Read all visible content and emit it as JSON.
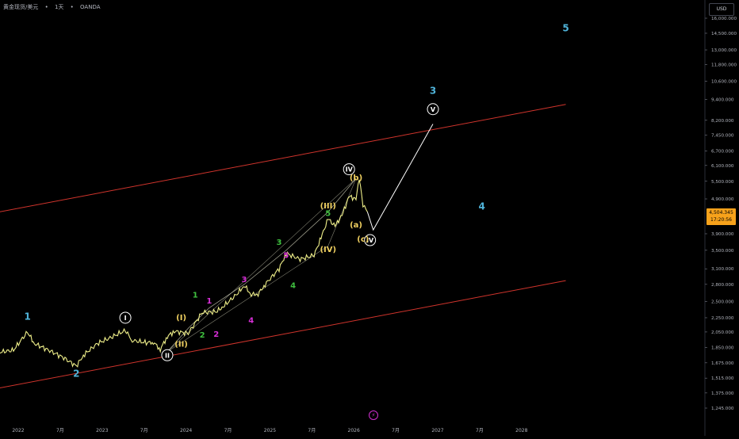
{
  "header": {
    "symbol": "黄金现货/美元",
    "sep1": "•",
    "interval": "1天",
    "sep2": "•",
    "broker": "OANDA"
  },
  "toolbar": {
    "currency": "USD"
  },
  "price_tag": {
    "price": "4,504.345",
    "countdown": "17:20:56"
  },
  "live_icon": "⚡",
  "colors": {
    "background": "#000000",
    "price_line": "#f0f08a",
    "channel": "#d0342c",
    "wave_lines": "#d8d8c0",
    "cyan": "#4fb3d9",
    "green": "#3fbf3f",
    "magenta": "#d62fd6",
    "yellow": "#f0d060",
    "white": "#ffffff",
    "tag": "#f7a21b"
  },
  "chart_data": {
    "type": "line",
    "log_scale": true,
    "grid": false,
    "x_ticks": [
      "2022",
      "7月",
      "2023",
      "7月",
      "2024",
      "7月",
      "2025",
      "7月",
      "2026",
      "7月",
      "2027",
      "7月",
      "2028"
    ],
    "y_ticks": [
      "16,000.000",
      "14,500.000",
      "13,000.000",
      "11,800.000",
      "10,600.000",
      "9,400.000",
      "8,200.000",
      "7,450.000",
      "6,700.000",
      "6,100.000",
      "5,500.000",
      "4,900.000",
      "3,900.000",
      "3,500.000",
      "3,100.000",
      "2,800.000",
      "2,500.000",
      "2,250.000",
      "2,050.000",
      "1,850.000",
      "1,675.000",
      "1,515.000",
      "1,375.000",
      "1,245.000"
    ],
    "xlim": [
      "2022-01",
      "2028-08"
    ],
    "ylim": [
      1200,
      17000
    ],
    "series": [
      {
        "points": [
          [
            "2021-11",
            1795
          ],
          [
            "2022-01",
            1820
          ],
          [
            "2022-03",
            2050
          ],
          [
            "2022-04",
            1900
          ],
          [
            "2022-06",
            1820
          ],
          [
            "2022-08",
            1740
          ],
          [
            "2022-10",
            1640
          ],
          [
            "2022-11",
            1760
          ],
          [
            "2023-01",
            1900
          ],
          [
            "2023-03",
            1980
          ],
          [
            "2023-05",
            2070
          ],
          [
            "2023-06",
            1940
          ],
          [
            "2023-08",
            1910
          ],
          [
            "2023-09",
            1920
          ],
          [
            "2023-10",
            1830
          ],
          [
            "2023-11",
            1990
          ],
          [
            "2023-12",
            2060
          ],
          [
            "2024-02",
            2030
          ],
          [
            "2024-04",
            2330
          ],
          [
            "2024-06",
            2340
          ],
          [
            "2024-07",
            2420
          ],
          [
            "2024-09",
            2630
          ],
          [
            "2024-10",
            2780
          ],
          [
            "2024-11",
            2620
          ],
          [
            "2024-12",
            2630
          ],
          [
            "2025-01",
            2800
          ],
          [
            "2025-03",
            3100
          ],
          [
            "2025-04",
            3430
          ],
          [
            "2025-06",
            3300
          ],
          [
            "2025-08",
            3390
          ],
          [
            "2025-09",
            3800
          ],
          [
            "2025-10",
            4300
          ],
          [
            "2025-11",
            4100
          ],
          [
            "2025-12",
            4400
          ],
          [
            "2026-01",
            4980
          ],
          [
            "2026-02",
            4900
          ],
          [
            "2026-02-15",
            5600
          ],
          [
            "2026-03",
            4700
          ],
          [
            "2026-03-20",
            4500
          ]
        ]
      }
    ],
    "projection": [
      [
        "2026-03-20",
        4504
      ],
      [
        "2026-04-15",
        4000
      ],
      [
        "2027-01",
        8000
      ]
    ],
    "channel_upper": [
      [
        "2021-11",
        4500
      ],
      [
        "2028-08",
        9100
      ]
    ],
    "channel_lower": [
      [
        "2021-11",
        1420
      ],
      [
        "2028-08",
        2870
      ]
    ],
    "wave_labels": [
      {
        "text": "1",
        "date": "2022-03",
        "price": 2270,
        "color": "cyan",
        "circled": false
      },
      {
        "text": "2",
        "date": "2022-10",
        "price": 1560,
        "color": "cyan",
        "circled": false
      },
      {
        "text": "3",
        "date": "2027-01",
        "price": 9950,
        "color": "cyan",
        "circled": false
      },
      {
        "text": "4",
        "date": "2027-08",
        "price": 4670,
        "color": "cyan",
        "circled": false
      },
      {
        "text": "5",
        "date": "2028-08",
        "price": 15000,
        "color": "cyan",
        "circled": false
      },
      {
        "text": "I",
        "date": "2023-05",
        "price": 2250,
        "color": "white",
        "circled": true
      },
      {
        "text": "II",
        "date": "2023-11",
        "price": 1760,
        "color": "white",
        "circled": true
      },
      {
        "text": "IV",
        "date": "2026-04",
        "price": 3740,
        "color": "white",
        "circled": true
      },
      {
        "text": "V",
        "date": "2027-01",
        "price": 8820,
        "color": "white",
        "circled": true
      },
      {
        "text": "IV",
        "date": "2026-01",
        "price": 5950,
        "color": "white",
        "circled": true
      },
      {
        "text": "(I)",
        "date": "2024-01",
        "price": 2260,
        "color": "yellow",
        "circled": false
      },
      {
        "text": "(II)",
        "date": "2024-01",
        "price": 1900,
        "color": "yellow",
        "circled": false
      },
      {
        "text": "(III)",
        "date": "2025-10",
        "price": 4700,
        "color": "yellow",
        "circled": false
      },
      {
        "text": "(IV)",
        "date": "2025-10",
        "price": 3530,
        "color": "yellow",
        "circled": false
      },
      {
        "text": "(a)",
        "date": "2026-02",
        "price": 4150,
        "color": "yellow",
        "circled": false
      },
      {
        "text": "(b)",
        "date": "2026-02",
        "price": 5650,
        "color": "yellow",
        "circled": false
      },
      {
        "text": "(c)",
        "date": "2026-03",
        "price": 3780,
        "color": "yellow",
        "circled": false
      },
      {
        "text": "1",
        "date": "2024-03",
        "price": 2620,
        "color": "green",
        "circled": false
      },
      {
        "text": "2",
        "date": "2024-04",
        "price": 2020,
        "color": "green",
        "circled": false
      },
      {
        "text": "3",
        "date": "2025-03",
        "price": 3700,
        "color": "green",
        "circled": false
      },
      {
        "text": "4",
        "date": "2025-05",
        "price": 2790,
        "color": "green",
        "circled": false
      },
      {
        "text": "5",
        "date": "2025-10",
        "price": 4480,
        "color": "green",
        "circled": false
      },
      {
        "text": "1",
        "date": "2024-05",
        "price": 2520,
        "color": "magenta",
        "circled": false
      },
      {
        "text": "2",
        "date": "2024-06",
        "price": 2030,
        "color": "magenta",
        "circled": false
      },
      {
        "text": "3",
        "date": "2024-10",
        "price": 2900,
        "color": "magenta",
        "circled": false
      },
      {
        "text": "4",
        "date": "2024-11",
        "price": 2220,
        "color": "magenta",
        "circled": false
      },
      {
        "text": "5",
        "date": "2025-04",
        "price": 3400,
        "color": "magenta",
        "circled": false
      }
    ]
  }
}
